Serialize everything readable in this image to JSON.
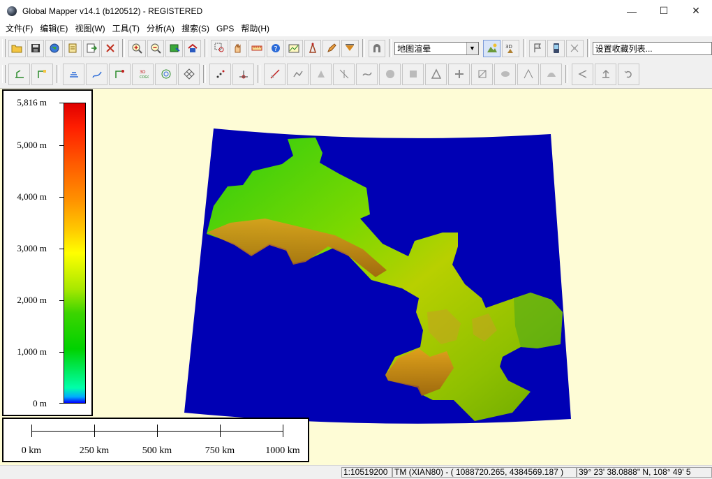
{
  "window": {
    "title": "Global Mapper v14.1 (b120512) - REGISTERED",
    "minimize_glyph": "—",
    "maximize_glyph": "☐",
    "close_glyph": "✕"
  },
  "menu": [
    "文件(F)",
    "编辑(E)",
    "视图(W)",
    "工具(T)",
    "分析(A)",
    "搜索(S)",
    "GPS",
    "帮助(H)"
  ],
  "toolbar": {
    "shader_select": "地图渲晕",
    "bookmark_select": "设置收藏列表..."
  },
  "legend": {
    "labels": [
      "5,816 m",
      "5,000 m",
      "4,000 m",
      "3,000 m",
      "2,000 m",
      "1,000 m",
      "0 m"
    ],
    "max_value_m": 5816
  },
  "scale_bar": {
    "labels": [
      "0 km",
      "250 km",
      "500 km",
      "750 km",
      "1000 km"
    ]
  },
  "status": {
    "scale": "1:10519200",
    "projection": "TM (XIAN80) - ( 1088720.265, 4384569.187 )",
    "latlon": "39° 23' 38.0888\" N, 108° 49' 5"
  },
  "colors": {
    "map_background": "#fefcd6",
    "dem_nodata": "#0000b4"
  }
}
